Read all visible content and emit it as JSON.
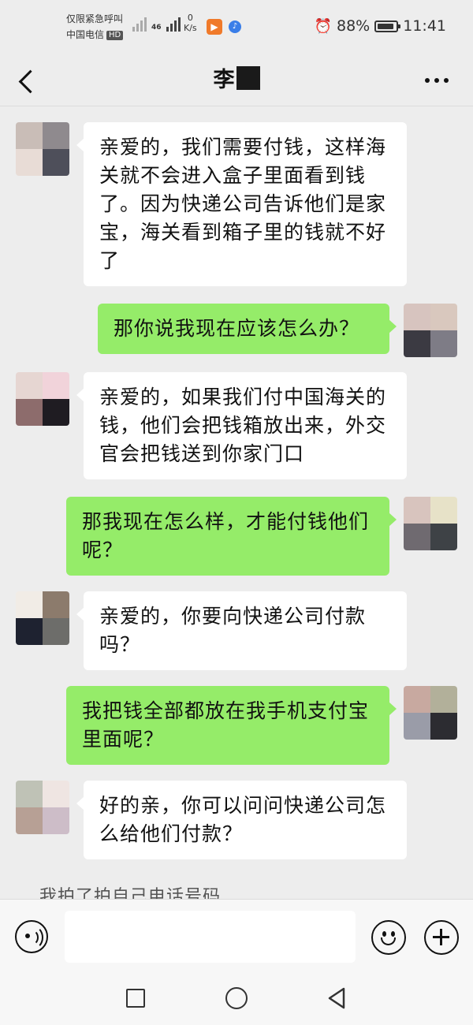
{
  "status_bar": {
    "emergency_text": "仅限紧急呼叫",
    "carrier": "中国电信",
    "hd_badge": "HD",
    "network_type": "46",
    "speed_value": "0",
    "speed_unit": "K/s",
    "battery_percent": "88%",
    "battery_level": 0.88,
    "time": "11:41",
    "icons": [
      "signal-icon",
      "alarm-icon",
      "battery-icon"
    ]
  },
  "header": {
    "title": "李",
    "back_icon": "chevron-left-icon",
    "more_icon": "more-dots-icon"
  },
  "messages": [
    {
      "from": "contact",
      "text": "亲爱的，我们需要付钱，这样海关就不会进入盒子里面看到钱了。因为快递公司告诉他们是家宝，海关看到箱子里的钱就不好了"
    },
    {
      "from": "me",
      "text": "那你说我现在应该怎么办？"
    },
    {
      "from": "contact",
      "text": "亲爱的，如果我们付中国海关的钱，他们会把钱箱放出来，外交官会把钱送到你家门口"
    },
    {
      "from": "me",
      "text": "那我现在怎么样，才能付钱他们呢？"
    },
    {
      "from": "contact",
      "text": "亲爱的，你要向快递公司付款吗？"
    },
    {
      "from": "me",
      "text": "我把钱全部都放在我手机支付宝里面呢？"
    },
    {
      "from": "contact",
      "text": "好的亲，你可以问问快递公司怎么给他们付款？"
    }
  ],
  "partial_message": "我拍了拍自己电话号码",
  "input_bar": {
    "placeholder": "",
    "voice_icon": "voice-icon",
    "emoji_icon": "emoji-icon",
    "plus_icon": "plus-icon"
  },
  "nav_bar": {
    "icons": [
      "recent-apps-icon",
      "home-icon",
      "back-icon"
    ]
  },
  "colors": {
    "background": "#ededed",
    "incoming_bubble": "#ffffff",
    "outgoing_bubble": "#95ec69",
    "masked": "#1a1a1a"
  }
}
